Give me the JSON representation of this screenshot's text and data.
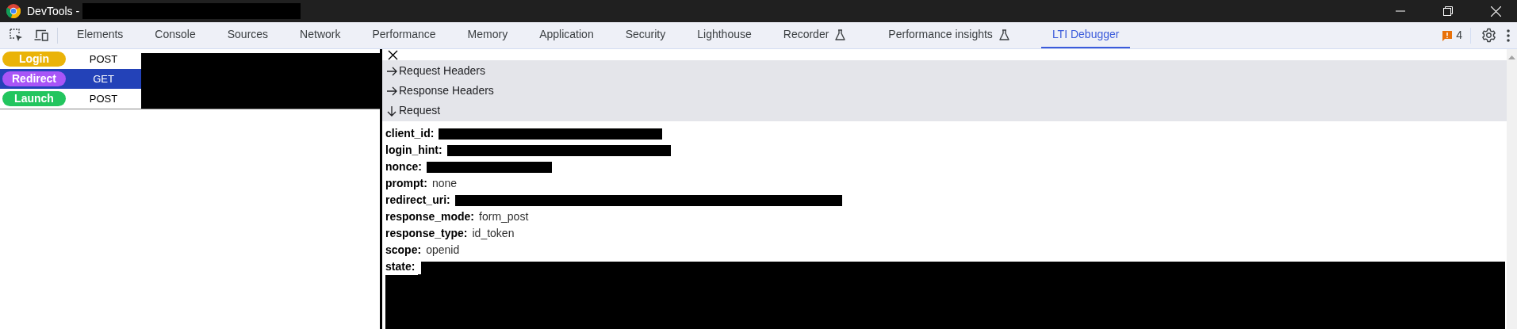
{
  "window": {
    "title": "DevTools -",
    "title_redacted": true
  },
  "tabs": [
    {
      "label": "Elements",
      "selected": false,
      "experimental": false
    },
    {
      "label": "Console",
      "selected": false,
      "experimental": false
    },
    {
      "label": "Sources",
      "selected": false,
      "experimental": false
    },
    {
      "label": "Network",
      "selected": false,
      "experimental": false
    },
    {
      "label": "Performance",
      "selected": false,
      "experimental": false
    },
    {
      "label": "Memory",
      "selected": false,
      "experimental": false
    },
    {
      "label": "Application",
      "selected": false,
      "experimental": false
    },
    {
      "label": "Security",
      "selected": false,
      "experimental": false
    },
    {
      "label": "Lighthouse",
      "selected": false,
      "experimental": false
    },
    {
      "label": "Recorder",
      "selected": false,
      "experimental": true
    },
    {
      "label": "Performance insights",
      "selected": false,
      "experimental": true
    },
    {
      "label": "LTI Debugger",
      "selected": true,
      "experimental": false
    }
  ],
  "issues": {
    "count": "4"
  },
  "requests": [
    {
      "type": "Login",
      "method": "POST",
      "color": "#eab308",
      "selected": false
    },
    {
      "type": "Redirect",
      "method": "GET",
      "color": "#a855f7",
      "selected": true
    },
    {
      "type": "Launch",
      "method": "POST",
      "color": "#22c55e",
      "selected": false
    }
  ],
  "sections": [
    {
      "label": "Request Headers",
      "expanded": false
    },
    {
      "label": "Response Headers",
      "expanded": false
    },
    {
      "label": "Request",
      "expanded": true
    }
  ],
  "fields": [
    {
      "name": "client_id:",
      "redacted": true
    },
    {
      "name": "login_hint:",
      "redacted": true
    },
    {
      "name": "nonce:",
      "redacted": true
    },
    {
      "name": "prompt:",
      "value": "none",
      "redacted": false
    },
    {
      "name": "redirect_uri:",
      "redacted": true
    },
    {
      "name": "response_mode:",
      "value": "form_post",
      "redacted": false
    },
    {
      "name": "response_type:",
      "value": "id_token",
      "redacted": false
    },
    {
      "name": "scope:",
      "value": "openid",
      "redacted": false
    },
    {
      "name": "state:",
      "redacted": true,
      "kind": "block"
    }
  ]
}
